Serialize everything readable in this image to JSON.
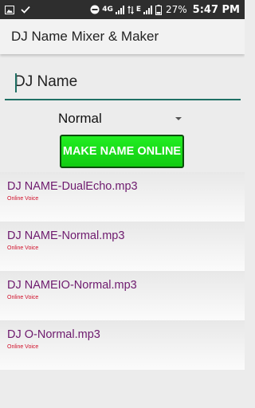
{
  "status_bar": {
    "network": "4G",
    "network2": "E",
    "battery": "27%",
    "time": "5:47 PM",
    "icons": [
      "image-icon",
      "check-icon",
      "do-not-disturb-icon",
      "signal-icon",
      "data-sync-icon",
      "signal-icon",
      "battery-icon"
    ]
  },
  "app_bar": {
    "title": "DJ Name Mixer & Maker"
  },
  "name_input": {
    "value": "DJ Name",
    "placeholder": ""
  },
  "voice_spinner": {
    "selected": "Normal"
  },
  "make_button": {
    "label": "MAKE NAME ONLINE",
    "color": "#11cc11"
  },
  "files": [
    {
      "name": "DJ NAME-DualEcho.mp3",
      "subtitle": "Online Voice"
    },
    {
      "name": "DJ NAME-Normal.mp3",
      "subtitle": "Online Voice"
    },
    {
      "name": "DJ NAMEIO-Normal.mp3",
      "subtitle": "Online Voice"
    },
    {
      "name": "DJ O-Normal.mp3",
      "subtitle": "Online Voice"
    }
  ],
  "colors": {
    "status_bar": "#2e2e2e",
    "accent": "#1f6f64",
    "file_name": "#6e1a6e",
    "file_subtitle": "#d0102a"
  }
}
